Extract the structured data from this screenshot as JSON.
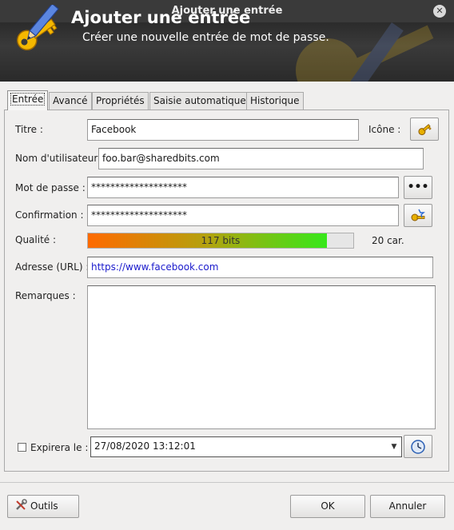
{
  "window": {
    "title": "Ajouter une entrée",
    "close_glyph": "✕"
  },
  "banner": {
    "title": "Ajouter une entrée",
    "subtitle": "Créer une nouvelle entrée de mot de passe.",
    "icon": "key-pen-icon"
  },
  "tabs": [
    {
      "label": "Entrée",
      "active": true
    },
    {
      "label": "Avancé"
    },
    {
      "label": "Propriétés"
    },
    {
      "label": "Saisie automatique"
    },
    {
      "label": "Historique"
    }
  ],
  "form": {
    "title_label": "Titre :",
    "title_value": "Facebook",
    "icon_label": "Icône :",
    "username_label": "Nom d'utilisateur :",
    "username_value": "foo.bar@sharedbits.com",
    "password_label": "Mot de passe :",
    "password_value": "********************",
    "reveal_glyph": "•••",
    "confirm_label": "Confirmation :",
    "confirm_value": "********************",
    "quality_label": "Qualité :",
    "quality_text": "117 bits",
    "quality_fraction": 0.9,
    "char_count": "20 car.",
    "url_label": "Adresse (URL) :",
    "url_value": "https://www.facebook.com",
    "notes_label": "Remarques :",
    "notes_value": "",
    "expires_label": "Expirera le :",
    "expires_checked": false,
    "expires_value": "27/08/2020 13:12:01",
    "dropdown_glyph": "▼"
  },
  "footer": {
    "tools_label": "Outils",
    "ok_label": "OK",
    "cancel_label": "Annuler"
  },
  "colors": {
    "url_text": "#1a1acc",
    "banner_bg": "#2f2f2f",
    "titlebar_bg": "#3a3a3a"
  }
}
